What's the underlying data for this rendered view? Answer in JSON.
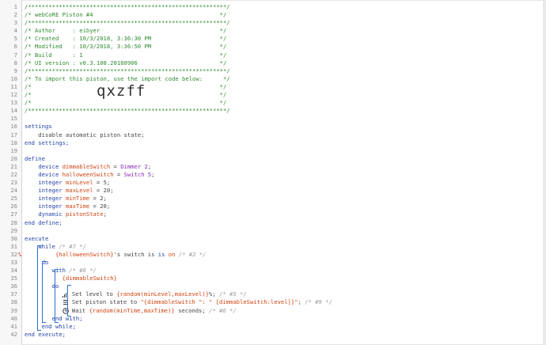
{
  "lines": [
    {
      "n": "1",
      "t": "/**********************************************************/",
      "cls": "c"
    },
    {
      "n": "2",
      "t": "/* webCoRE Piston #4                                     */",
      "cls": "c"
    },
    {
      "n": "3",
      "t": "/**********************************************************/",
      "cls": "c"
    },
    {
      "n": "4",
      "t": "/* Author     : eibyer                                   */",
      "cls": "c"
    },
    {
      "n": "5",
      "t": "/* Created    : 10/3/2018, 3:36:30 PM                    */",
      "cls": "c"
    },
    {
      "n": "6",
      "t": "/* Modified   : 10/3/2018, 3:36:50 PM                    */",
      "cls": "c"
    },
    {
      "n": "7",
      "t": "/* Build      : 1                                        */",
      "cls": "c"
    },
    {
      "n": "8",
      "t": "/* UI version : v0.3.108.20180906                        */",
      "cls": "c"
    },
    {
      "n": "9",
      "t": "/**********************************************************/",
      "cls": "c"
    },
    {
      "n": "10",
      "t": "/* To import this piston, use the import code below:      */",
      "cls": "c"
    },
    {
      "n": "11",
      "t": "/*                                                       */",
      "cls": "c"
    },
    {
      "n": "12",
      "t": "/*                                                       */",
      "cls": "c"
    },
    {
      "n": "13",
      "t": "/*                                                       */",
      "cls": "c"
    },
    {
      "n": "14",
      "t": "/**********************************************************/",
      "cls": "c"
    },
    {
      "n": "15",
      "t": ""
    },
    {
      "n": "16",
      "t": "settings",
      "cls": "k"
    },
    {
      "n": "17",
      "t": "    disable automatic piston state;",
      "cls": "op"
    },
    {
      "n": "18",
      "t": "end settings;",
      "cls": "k"
    },
    {
      "n": "19",
      "t": ""
    },
    {
      "n": "20",
      "t": "define",
      "cls": "k"
    },
    {
      "n": "21"
    },
    {
      "n": "22"
    },
    {
      "n": "23"
    },
    {
      "n": "24"
    },
    {
      "n": "25"
    },
    {
      "n": "26"
    },
    {
      "n": "27"
    },
    {
      "n": "28",
      "t": "end define;",
      "cls": "k"
    },
    {
      "n": "29",
      "t": ""
    },
    {
      "n": "30",
      "t": "execute",
      "cls": "k"
    },
    {
      "n": "31"
    },
    {
      "n": "32"
    },
    {
      "n": "33"
    },
    {
      "n": "34"
    },
    {
      "n": "35"
    },
    {
      "n": "36"
    },
    {
      "n": "37"
    },
    {
      "n": "38"
    },
    {
      "n": "39"
    },
    {
      "n": "40"
    },
    {
      "n": "41"
    },
    {
      "n": "42",
      "t": "end execute;",
      "cls": "k"
    }
  ],
  "import_code": "qxzff",
  "define": {
    "dimmable_device": "dimmableSwitch",
    "dimmable_value": "Dimmer 2",
    "halloween_device": "halloweenSwitch",
    "halloween_value": "Switch 5",
    "minLevel": "minLevel",
    "minLevel_val": "5",
    "maxLevel": "maxLevel",
    "maxLevel_val": "20",
    "minTime": "minTime",
    "minTime_val": "2",
    "maxTime": "maxTime",
    "maxTime_val": "20",
    "pistonState": "pistonState"
  },
  "execute": {
    "while_kw": "while",
    "c7": "/* #7 */",
    "halloween_ref": "{halloweenSwitch}",
    "switch_is": "'s switch is",
    "on": "on",
    "c2": "/* #2 */",
    "do": "do",
    "with_kw": "with",
    "c8": "/* #8 */",
    "dimmable_ref": "{dimmableSwitch}",
    "set_level_prefix": "Set level to",
    "set_level_expr": "{random(minLevel,maxLevel)}",
    "set_level_suffix": "%;",
    "c5": "/* #5 */",
    "set_state_prefix": "Set piston state to",
    "set_state_expr": "\"{dimmableSwitch \": \" [dimmableSwitch:level]}\"",
    "set_state_suffix": ";",
    "c9": "/* #9 */",
    "wait_prefix": "Wait",
    "wait_expr": "{random(minTime,maxTime)}",
    "wait_suffix": "seconds;",
    "c6": "/* #6 */",
    "end_with": "end with;",
    "end_while": "end while;"
  },
  "gutter_marker": "%",
  "colors": {
    "comment": "#2e8b2e",
    "keyword": "#2244aa",
    "device": "#d04411",
    "variable": "#8a2bb8",
    "bracket": "#2b6fd6",
    "marker": "#e84b2d"
  }
}
